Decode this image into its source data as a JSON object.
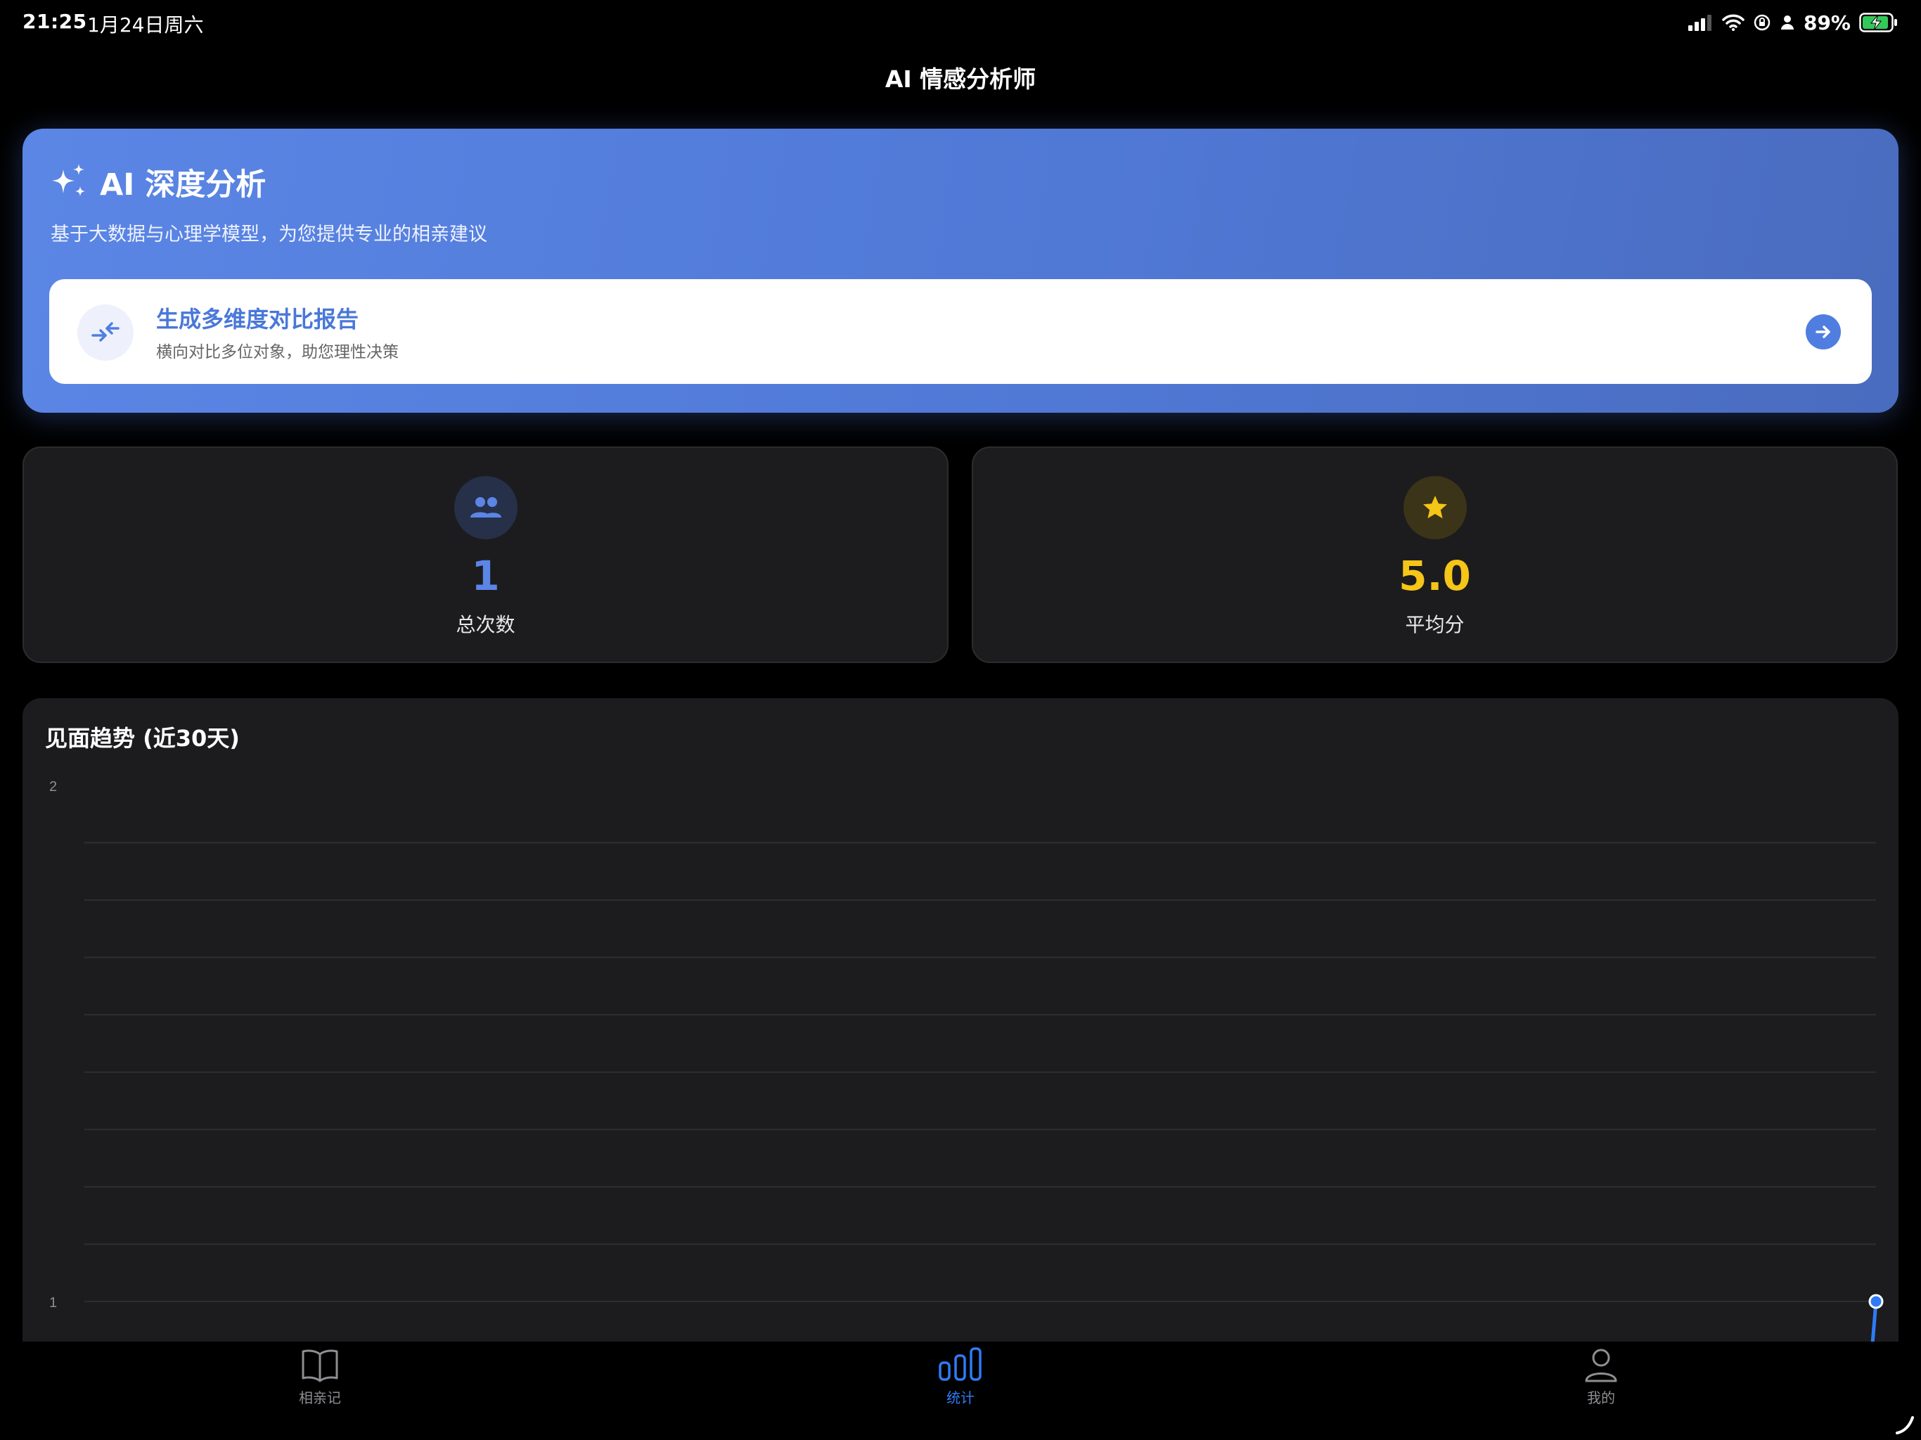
{
  "status_bar": {
    "time": "21:25",
    "date": "1月24日周六",
    "battery": "89%"
  },
  "nav": {
    "title": "AI 情感分析师"
  },
  "hero": {
    "title": "AI 深度分析",
    "subtitle": "基于大数据与心理学模型，为您提供专业的相亲建议",
    "action": {
      "title": "生成多维度对比报告",
      "description": "横向对比多位对象，助您理性决策"
    }
  },
  "stats": [
    {
      "value": "1",
      "label": "总次数",
      "icon": "people-icon",
      "color": "#4f7ee0"
    },
    {
      "value": "5.0",
      "label": "平均分",
      "icon": "star-icon",
      "color": "#f5c518"
    }
  ],
  "chart_data": {
    "type": "line",
    "title": "见面趋势 (近30天)",
    "ylim": [
      1,
      2
    ],
    "y_ticks": [
      "2",
      "1"
    ],
    "series": [
      {
        "values": [
          1
        ]
      }
    ],
    "grid": true,
    "color": "#2f7bf6"
  },
  "tabs": [
    {
      "label": "相亲记",
      "icon": "book-icon",
      "active": false
    },
    {
      "label": "统计",
      "icon": "bar-chart-icon",
      "active": true
    },
    {
      "label": "我的",
      "icon": "person-icon",
      "active": false
    }
  ]
}
